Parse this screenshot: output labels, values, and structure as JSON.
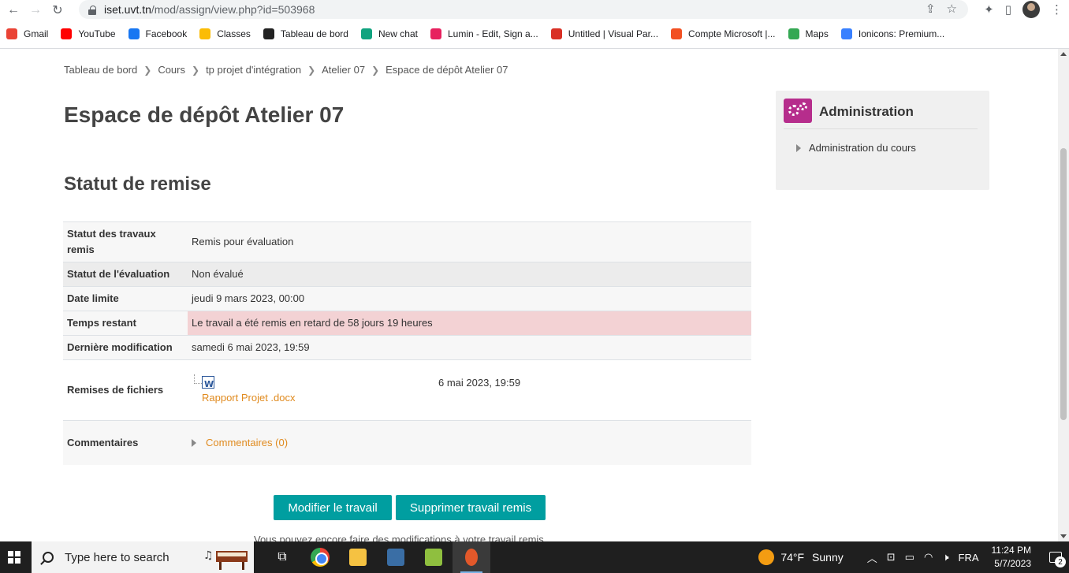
{
  "browser": {
    "url_host": "iset.uvt.tn",
    "url_path": "/mod/assign/view.php?id=503968",
    "bookmarks": [
      {
        "label": "Gmail",
        "color": "#ea4335"
      },
      {
        "label": "YouTube",
        "color": "#ff0000"
      },
      {
        "label": "Facebook",
        "color": "#1877f2"
      },
      {
        "label": "Classes",
        "color": "#fbbc05"
      },
      {
        "label": "Tableau de bord",
        "color": "#222222"
      },
      {
        "label": "New chat",
        "color": "#10a37f"
      },
      {
        "label": "Lumin - Edit, Sign a...",
        "color": "#e7215e"
      },
      {
        "label": "Untitled | Visual Par...",
        "color": "#d93025"
      },
      {
        "label": "Compte Microsoft |...",
        "color": "#f25022"
      },
      {
        "label": "Maps",
        "color": "#34a853"
      },
      {
        "label": "Ionicons: Premium...",
        "color": "#3880ff"
      }
    ]
  },
  "breadcrumb": [
    "Tableau de bord",
    "Cours",
    "tp projet d'intégration",
    "Atelier 07",
    "Espace de dépôt Atelier 07"
  ],
  "page_title": "Espace de dépôt Atelier 07",
  "section_title": "Statut de remise",
  "status": {
    "submission_label": "Statut des travaux remis",
    "submission_value": "Remis pour évaluation",
    "grading_label": "Statut de l'évaluation",
    "grading_value": "Non évalué",
    "due_label": "Date limite",
    "due_value": "jeudi 9 mars 2023, 00:00",
    "remaining_label": "Temps restant",
    "remaining_value": "Le travail a été remis en retard de 58 jours 19 heures",
    "modified_label": "Dernière modification",
    "modified_value": "samedi 6 mai 2023, 19:59",
    "files_label": "Remises de fichiers",
    "file_name": "Rapport Projet .docx",
    "file_date": "6 mai 2023, 19:59",
    "comments_label": "Commentaires",
    "comments_link": "Commentaires (0)"
  },
  "buttons": {
    "modify": "Modifier le travail",
    "delete": "Supprimer travail remis"
  },
  "hint": "Vous pouvez encore faire des modifications à votre travail remis.",
  "admin": {
    "title": "Administration",
    "item": "Administration du cours"
  },
  "taskbar": {
    "search_placeholder": "Type here to search",
    "temperature": "74°F",
    "weather": "Sunny",
    "language": "FRA",
    "time": "11:24 PM",
    "date": "5/7/2023",
    "notifications": "2"
  }
}
